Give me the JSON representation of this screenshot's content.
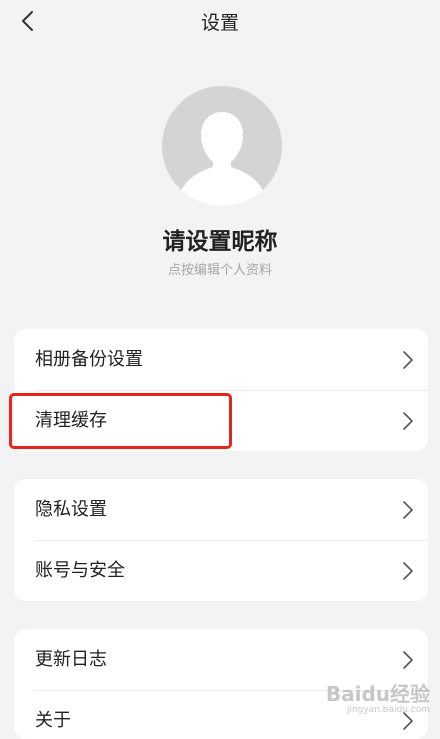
{
  "header": {
    "title": "设置",
    "back_icon": "chevron-left-icon"
  },
  "profile": {
    "avatar_icon": "default-avatar-icon",
    "nickname": "请设置昵称",
    "subtitle": "点按编辑个人资料"
  },
  "groups": [
    {
      "items": [
        {
          "label": "相册备份设置",
          "icon": "chevron-right-icon"
        },
        {
          "label": "清理缓存",
          "icon": "chevron-right-icon"
        }
      ]
    },
    {
      "items": [
        {
          "label": "隐私设置",
          "icon": "chevron-right-icon"
        },
        {
          "label": "账号与安全",
          "icon": "chevron-right-icon"
        }
      ]
    },
    {
      "items": [
        {
          "label": "更新日志",
          "icon": "chevron-right-icon"
        },
        {
          "label": "关于",
          "icon": "chevron-right-icon"
        }
      ]
    }
  ],
  "annotation": {
    "highlight_color": "#e8231b",
    "highlighted_item": "清理缓存"
  },
  "watermark": {
    "main": "Baidu经验",
    "sub": "jingyan.baidu.com"
  }
}
